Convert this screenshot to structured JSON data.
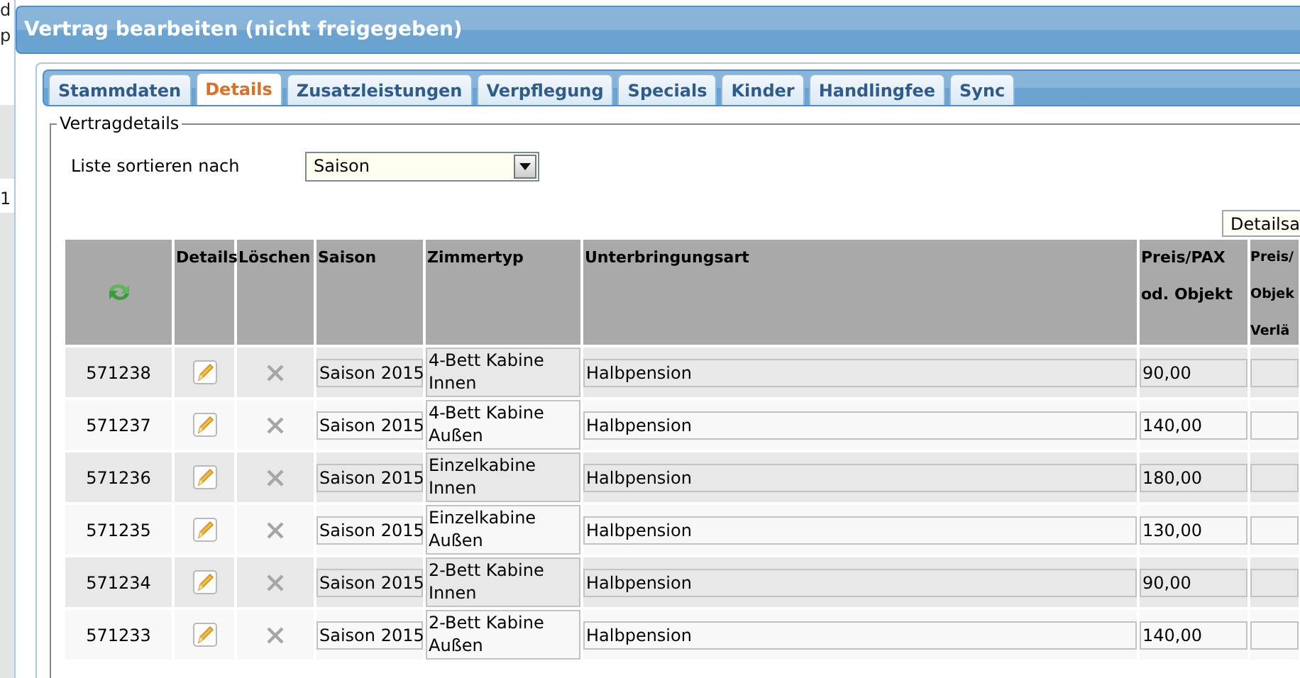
{
  "background_fragments": [
    "d",
    "p",
    "1"
  ],
  "window": {
    "title": "Vertrag bearbeiten (nicht freigegeben)"
  },
  "tabs": [
    {
      "label": "Stammdaten",
      "selected": false
    },
    {
      "label": "Details",
      "selected": true
    },
    {
      "label": "Zusatzleistungen",
      "selected": false
    },
    {
      "label": "Verpflegung",
      "selected": false
    },
    {
      "label": "Specials",
      "selected": false
    },
    {
      "label": "Kinder",
      "selected": false
    },
    {
      "label": "Handlingfee",
      "selected": false
    },
    {
      "label": "Sync",
      "selected": false
    }
  ],
  "fieldset": {
    "legend": "Vertragdetails",
    "sort_label": "Liste sortieren nach",
    "sort_value": "Saison",
    "tooltip": "Detailsa"
  },
  "table": {
    "columns": [
      {
        "kind": "refresh"
      },
      {
        "kind": "text",
        "lines": [
          "Details"
        ]
      },
      {
        "kind": "text",
        "lines": [
          "Löschen"
        ]
      },
      {
        "kind": "text",
        "lines": [
          "Saison"
        ]
      },
      {
        "kind": "text",
        "lines": [
          "Zimmertyp"
        ]
      },
      {
        "kind": "text",
        "lines": [
          "Unterbringungsart"
        ]
      },
      {
        "kind": "text",
        "lines": [
          "Preis/PAX",
          "od. Objekt"
        ]
      },
      {
        "kind": "text",
        "lines": [
          "Preis/",
          "Objek",
          "Verlä"
        ]
      }
    ],
    "rows": [
      {
        "id": "571238",
        "saison": "Saison 2015",
        "zimmertyp": "4-Bett Kabine Innen",
        "unterbringung": "Halbpension",
        "preis": "90,00"
      },
      {
        "id": "571237",
        "saison": "Saison 2015",
        "zimmertyp": "4-Bett Kabine Außen",
        "unterbringung": "Halbpension",
        "preis": "140,00"
      },
      {
        "id": "571236",
        "saison": "Saison 2015",
        "zimmertyp": "Einzelkabine Innen",
        "unterbringung": "Halbpension",
        "preis": "180,00"
      },
      {
        "id": "571235",
        "saison": "Saison 2015",
        "zimmertyp": "Einzelkabine Außen",
        "unterbringung": "Halbpension",
        "preis": "130,00"
      },
      {
        "id": "571234",
        "saison": "Saison 2015",
        "zimmertyp": "2-Bett Kabine Innen",
        "unterbringung": "Halbpension",
        "preis": "90,00"
      },
      {
        "id": "571233",
        "saison": "Saison 2015",
        "zimmertyp": "2-Bett Kabine Außen",
        "unterbringung": "Halbpension",
        "preis": "140,00"
      }
    ]
  }
}
